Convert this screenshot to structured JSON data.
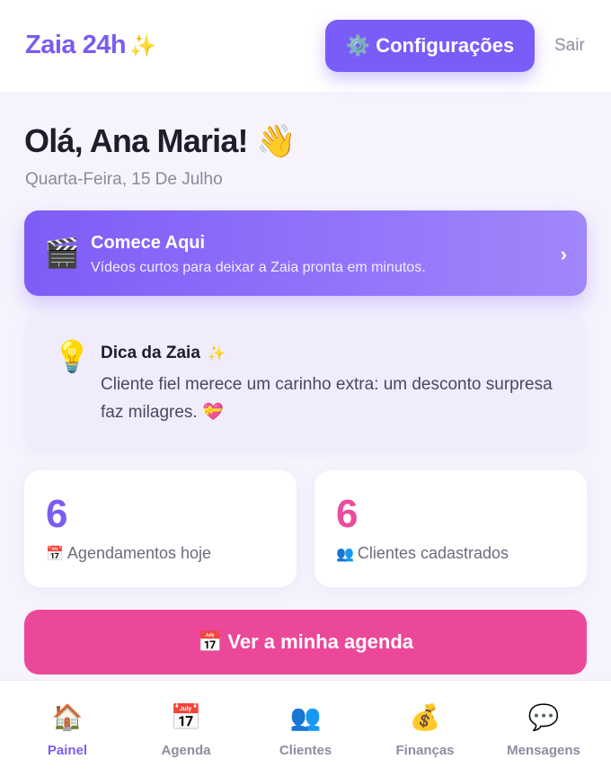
{
  "header": {
    "brand": "Zaia 24h",
    "brand_icon": "✨",
    "config_icon": "⚙️",
    "config_label": "Configurações",
    "logout_label": "Sair"
  },
  "greeting": {
    "title": "Olá, Ana Maria! 👋",
    "date": "Quarta-Feira, 15 De Julho"
  },
  "start_card": {
    "icon": "🎬",
    "title": "Comece Aqui",
    "subtitle": "Vídeos curtos para deixar a Zaia pronta em minutos.",
    "chevron": "›"
  },
  "tip": {
    "icon": "💡",
    "title": "Dica da Zaia",
    "title_icon": "✨",
    "text": "Cliente fiel merece um carinho extra: um desconto surpresa faz milagres. 💝"
  },
  "stats": [
    {
      "value": "6",
      "icon": "📅",
      "label": "Agendamentos hoje",
      "color": "#7b5cf0"
    },
    {
      "value": "6",
      "icon": "👥",
      "label": "Clientes cadastrados",
      "color": "#ec4c9a"
    }
  ],
  "agenda_button": {
    "icon": "📅",
    "label": "Ver a minha agenda"
  },
  "nav": [
    {
      "icon": "🏠",
      "label": "Painel",
      "active": true
    },
    {
      "icon": "📅",
      "label": "Agenda",
      "active": false
    },
    {
      "icon": "👥",
      "label": "Clientes",
      "active": false
    },
    {
      "icon": "💰",
      "label": "Finanças",
      "active": false
    },
    {
      "icon": "💬",
      "label": "Mensagens",
      "active": false
    }
  ],
  "colors": {
    "accent": "#7b5cf0",
    "pink": "#ec4899",
    "background": "#f6f3fd"
  }
}
